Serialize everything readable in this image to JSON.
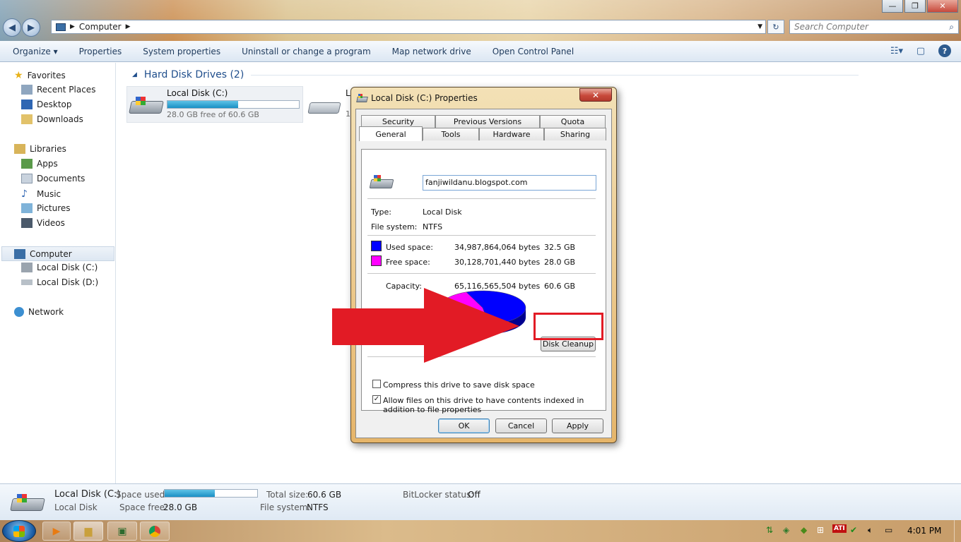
{
  "window": {
    "address_label": "Computer",
    "search_placeholder": "Search Computer",
    "minimize": "—",
    "maximize": "❐",
    "close": "✕"
  },
  "toolbar": {
    "organize": "Organize ▾",
    "properties": "Properties",
    "system_properties": "System properties",
    "uninstall": "Uninstall or change a program",
    "map_drive": "Map network drive",
    "control_panel": "Open Control Panel"
  },
  "nav": {
    "favorites": "Favorites",
    "recent_places": "Recent Places",
    "desktop": "Desktop",
    "downloads": "Downloads",
    "libraries": "Libraries",
    "apps": "Apps",
    "documents": "Documents",
    "music": "Music",
    "pictures": "Pictures",
    "videos": "Videos",
    "computer": "Computer",
    "local_c": "Local Disk (C:)",
    "local_d": "Local Disk (D:)",
    "network": "Network"
  },
  "content": {
    "group_header": "Hard Disk Drives (2)",
    "drive_c_name": "Local Disk (C:)",
    "drive_c_free": "28.0 GB free of 60.6 GB",
    "drive_c_used_fraction": 0.54,
    "drive_d_letter": "L",
    "drive_d_digit": "1"
  },
  "details": {
    "name": "Local Disk (C:)",
    "type": "Local Disk",
    "space_used_label": "Space used:",
    "space_free_label": "Space free:",
    "space_free_value": "28.0 GB",
    "total_size_label": "Total size:",
    "total_size_value": "60.6 GB",
    "fs_label": "File system:",
    "fs_value": "NTFS",
    "bitlocker_label": "BitLocker status:",
    "bitlocker_value": "Off",
    "used_fraction": 0.54
  },
  "dialog": {
    "title": "Local Disk (C:) Properties",
    "close": "✕",
    "tabs_top": [
      "Security",
      "Previous Versions",
      "Quota"
    ],
    "tabs_bottom": [
      "General",
      "Tools",
      "Hardware",
      "Sharing"
    ],
    "name_value": "fanjiwildanu.blogspot.com",
    "type_label": "Type:",
    "type_value": "Local Disk",
    "fs_label": "File system:",
    "fs_value": "NTFS",
    "used_label": "Used space:",
    "used_bytes": "34,987,864,064 bytes",
    "used_gb": "32.5 GB",
    "free_label": "Free space:",
    "free_bytes": "30,128,701,440 bytes",
    "free_gb": "28.0 GB",
    "capacity_label": "Capacity:",
    "capacity_bytes": "65,116,565,504 bytes",
    "capacity_gb": "60.6 GB",
    "disk_cleanup": "Disk Cleanup",
    "compress_label": "Compress this drive to save disk space",
    "compress_checked": false,
    "index_label": "Allow files on this drive to have contents indexed in addition to file properties",
    "index_checked": true,
    "ok": "OK",
    "cancel": "Cancel",
    "apply": "Apply",
    "used_color": "#0000ff",
    "free_color": "#ff00ff",
    "used_fraction": 0.537
  },
  "taskbar": {
    "clock": "4:01 PM",
    "tray_ati": "ATI"
  }
}
